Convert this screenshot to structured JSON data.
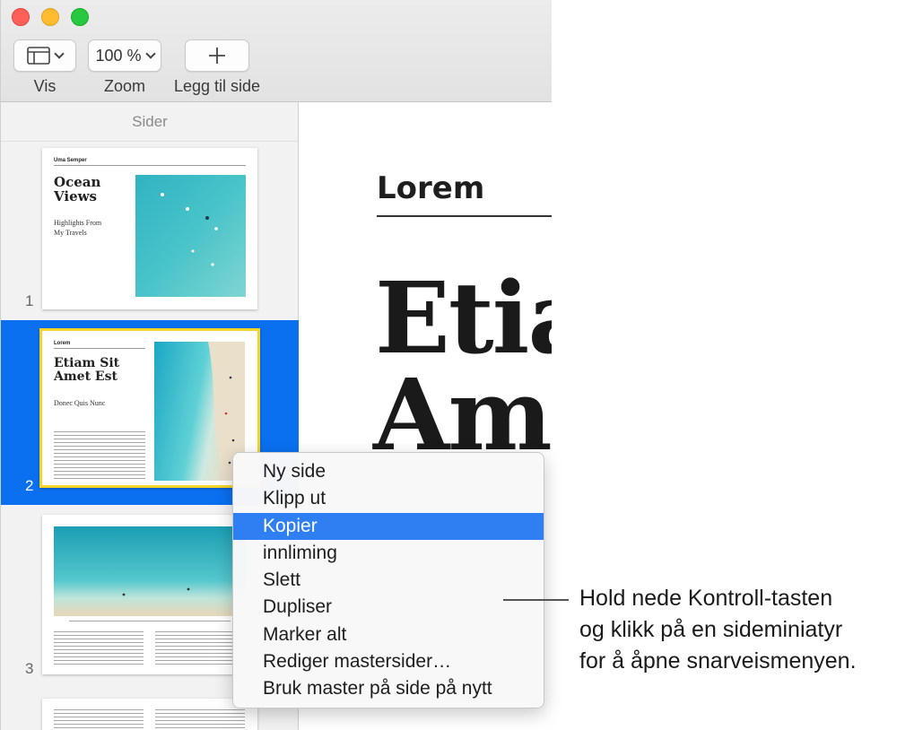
{
  "toolbar": {
    "vis_label": "Vis",
    "zoom_value": "100 %",
    "zoom_label": "Zoom",
    "add_page_label": "Legg til side"
  },
  "sidebar": {
    "title": "Sider",
    "pages": [
      {
        "number": "1",
        "kicker": "Uma Semper",
        "title_line1": "Ocean",
        "title_line2": "Views",
        "sub_line1": "Highlights From",
        "sub_line2": "My Travels"
      },
      {
        "number": "2",
        "kicker": "Lorem",
        "title_line1": "Etiam Sit",
        "title_line2": "Amet Est",
        "sub_line1": "Donec Quis Nunc"
      },
      {
        "number": "3"
      }
    ]
  },
  "document": {
    "heading": "Lorem",
    "big_line1": "Etiam",
    "big_line2": "Amet"
  },
  "context_menu": {
    "items": [
      "Ny side",
      "Klipp ut",
      "Kopier",
      "innliming",
      "Slett",
      "Dupliser",
      "Marker alt",
      "Rediger mastersider…",
      "Bruk master på side på nytt"
    ],
    "highlighted": "Kopier"
  },
  "callout": {
    "line1": "Hold nede Kontroll-tasten",
    "line2": "og klikk på en sideminiatyr",
    "line3": "for å åpne snarveismenyen."
  },
  "colors": {
    "selection_blue": "#0a70f0",
    "menu_highlight": "#2f7ff2",
    "thumb_border_yellow": "#f5d327"
  }
}
